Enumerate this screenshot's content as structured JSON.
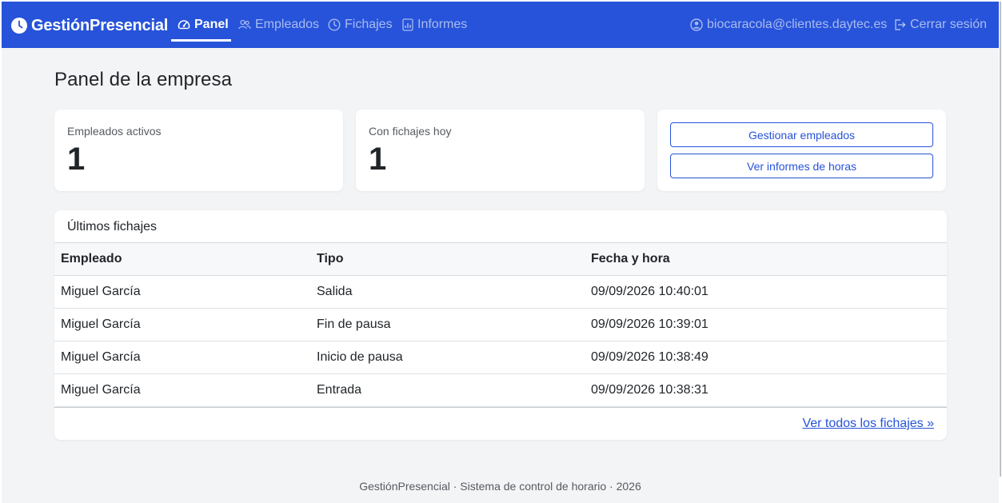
{
  "navbar": {
    "brand": "GestiónPresencial",
    "links": [
      {
        "label": "Panel",
        "icon": "gauge-icon",
        "active": true
      },
      {
        "label": "Empleados",
        "icon": "people-icon",
        "active": false
      },
      {
        "label": "Fichajes",
        "icon": "clock-icon",
        "active": false
      },
      {
        "label": "Informes",
        "icon": "report-icon",
        "active": false
      }
    ],
    "user_email": "biocaracola@clientes.daytec.es",
    "logout_label": "Cerrar sesión"
  },
  "page_title": "Panel de la empresa",
  "stats": [
    {
      "label": "Empleados activos",
      "value": "1"
    },
    {
      "label": "Con fichajes hoy",
      "value": "1"
    }
  ],
  "actions": {
    "manage_employees": "Gestionar empleados",
    "view_reports": "Ver informes de horas"
  },
  "recent": {
    "title": "Últimos fichajes",
    "columns": [
      "Empleado",
      "Tipo",
      "Fecha y hora"
    ],
    "rows": [
      [
        "Miguel García",
        "Salida",
        "09/09/2026 10:40:01"
      ],
      [
        "Miguel García",
        "Fin de pausa",
        "09/09/2026 10:39:01"
      ],
      [
        "Miguel García",
        "Inicio de pausa",
        "09/09/2026 10:38:49"
      ],
      [
        "Miguel García",
        "Entrada",
        "09/09/2026 10:38:31"
      ]
    ],
    "view_all": "Ver todos los fichajes »"
  },
  "footer": "GestiónPresencial · Sistema de control de horario · 2026",
  "colors": {
    "primary": "#2653d9",
    "background": "#f3f4f6"
  }
}
